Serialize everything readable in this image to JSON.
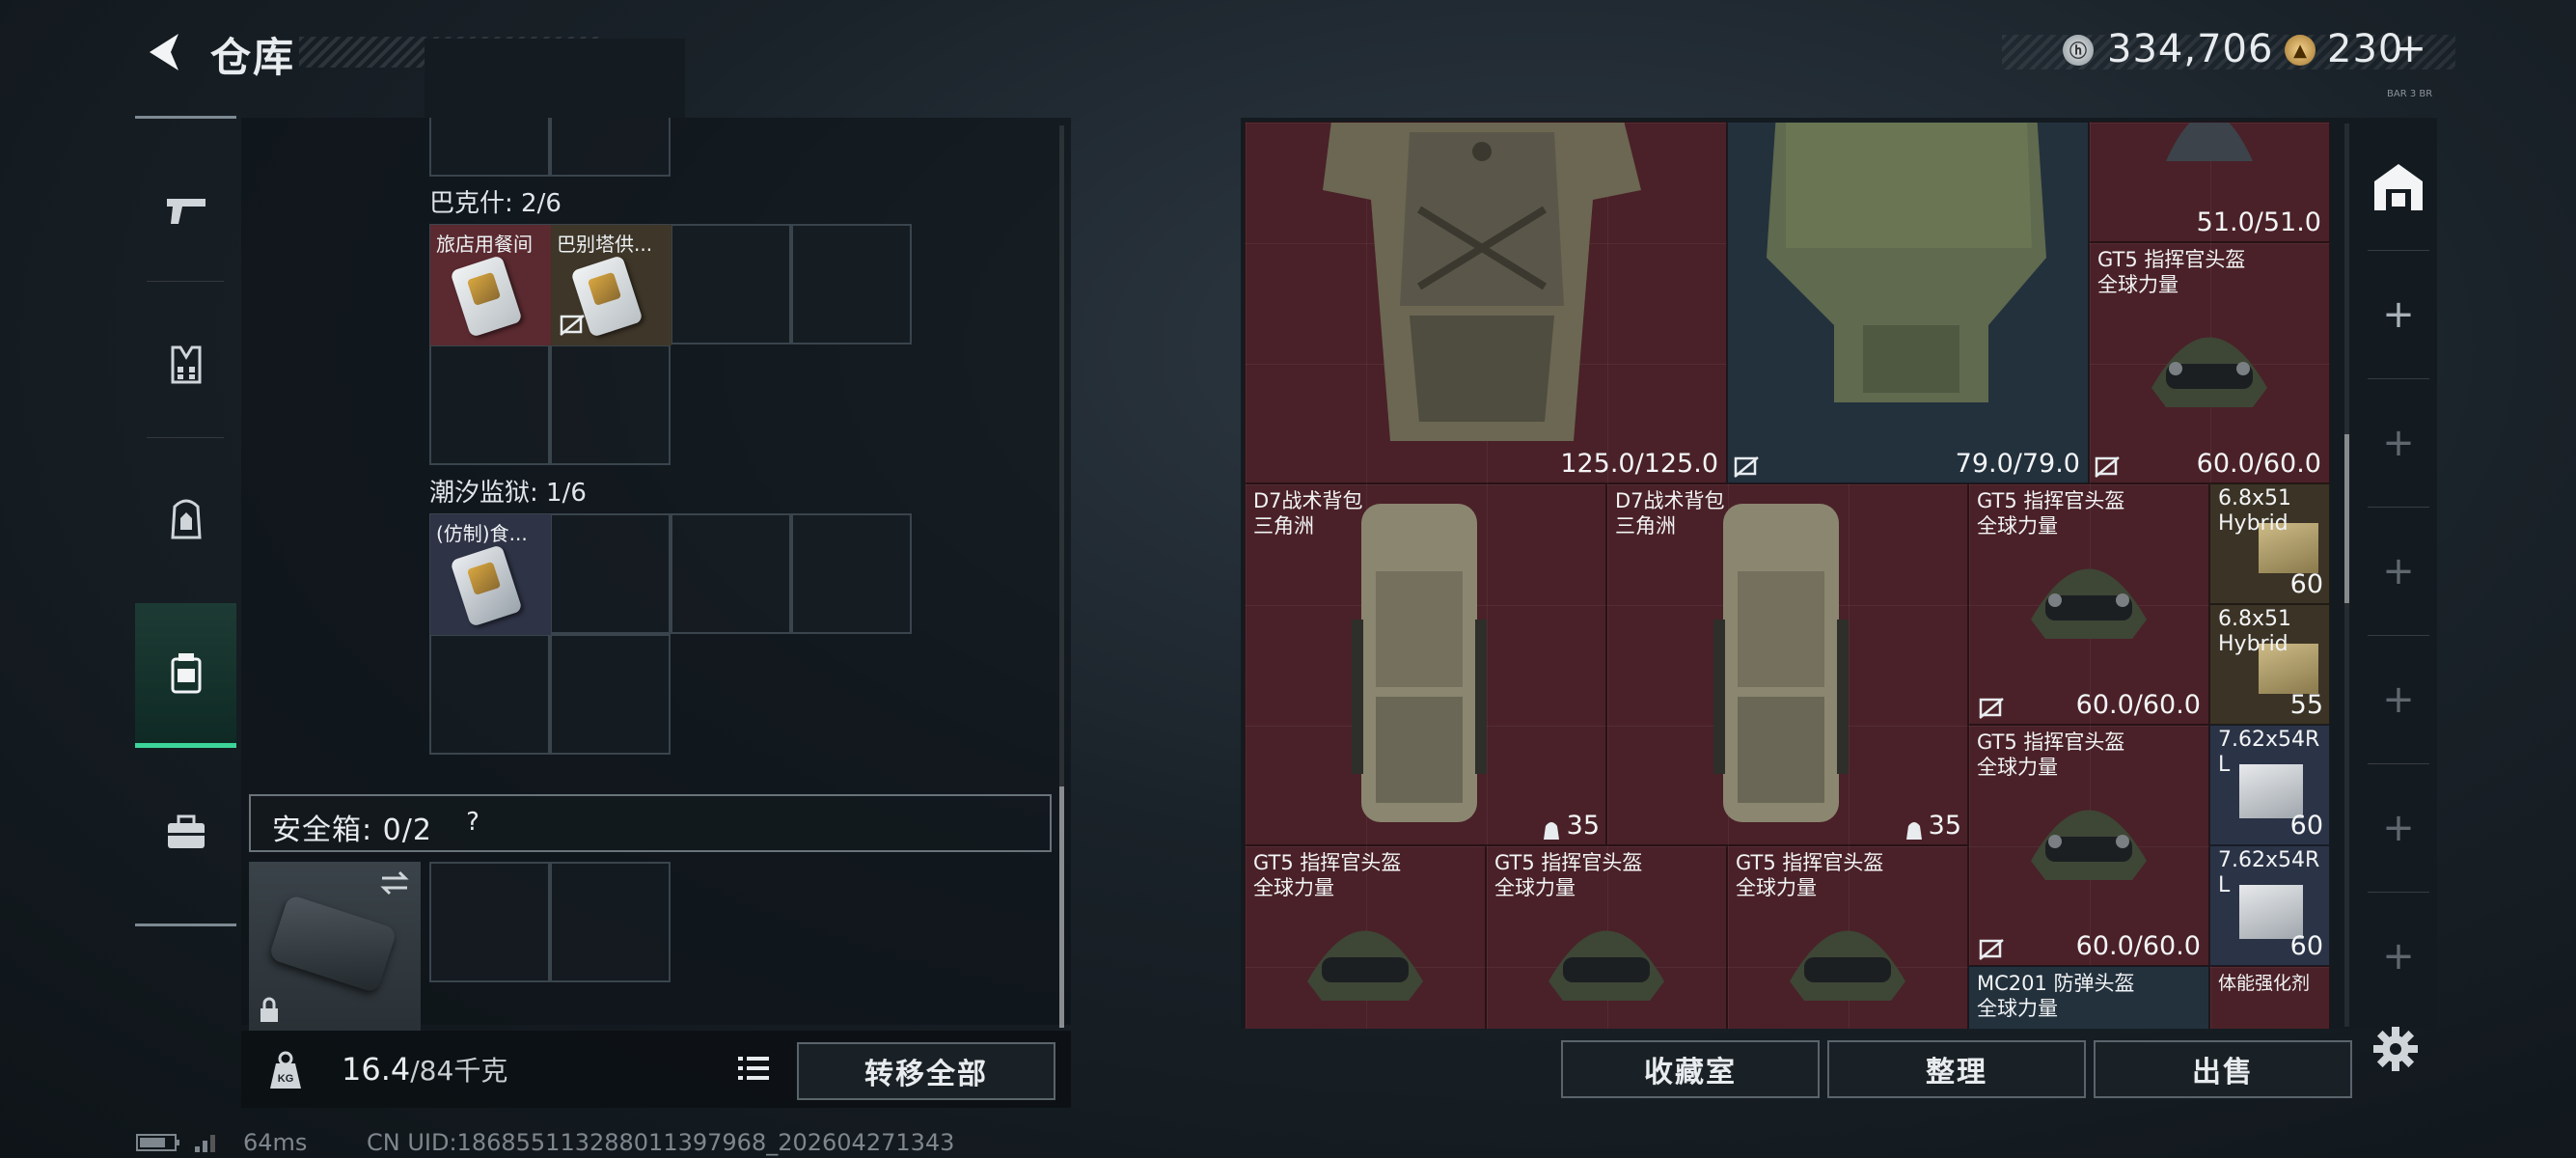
{
  "header": {
    "title": "仓库",
    "currency_a": "334,706",
    "currency_b": "230",
    "currency_b_add": "+",
    "tiny_text": "BAR 3 BR"
  },
  "storage_groups": [
    {
      "label": "巴克什: 2/6",
      "items": [
        "旅店用餐间",
        "巴别塔供..."
      ]
    },
    {
      "label": "潮汐监狱: 1/6",
      "items": [
        "(仿制)食..."
      ]
    }
  ],
  "safe_box": {
    "title": "安全箱: 0/2",
    "help": "?"
  },
  "weight": {
    "current": "16.4",
    "max": "/84千克",
    "lock_label": "KG"
  },
  "buttons": {
    "transfer_all": "转移全部",
    "collection": "收藏室",
    "sort": "整理",
    "sell": "出售"
  },
  "status": {
    "ping": "64ms",
    "uid": "CN UID:1868551132880113979​68_202604271343"
  },
  "warehouse_items": [
    {
      "id": "armor-1",
      "name": "",
      "durability": "125.0/125.0"
    },
    {
      "id": "armor-2",
      "name": "",
      "durability": "79.0/79.0"
    },
    {
      "id": "helmet-top",
      "name": "",
      "durability": "51.0/51.0"
    },
    {
      "id": "helmet-r1",
      "name": "GT5 指挥官头盔\n全球力量",
      "durability": "60.0/60.0"
    },
    {
      "id": "backpack-1",
      "name": "D7战术背包\n三角洲",
      "count": "35"
    },
    {
      "id": "backpack-2",
      "name": "D7战术背包\n三角洲",
      "count": "35"
    },
    {
      "id": "helmet-r2",
      "name": "GT5 指挥官头盔\n全球力量",
      "durability": "60.0/60.0"
    },
    {
      "id": "ammo-1",
      "name": "6.8x51\nHybrid",
      "qty": "60"
    },
    {
      "id": "ammo-2",
      "name": "6.8x51\nHybrid",
      "qty": "55"
    },
    {
      "id": "helmet-r3",
      "name": "GT5 指挥官头盔\n全球力量",
      "durability": "60.0/60.0"
    },
    {
      "id": "ammo-3",
      "name": "7.62x54R\nL",
      "qty": "60"
    },
    {
      "id": "ammo-4",
      "name": "7.62x54R\nL",
      "qty": "60"
    },
    {
      "id": "helmet-b1",
      "name": "GT5 指挥官头盔\n全球力量"
    },
    {
      "id": "helmet-b2",
      "name": "GT5 指挥官头盔\n全球力量"
    },
    {
      "id": "helmet-b3",
      "name": "GT5 指挥官头盔\n全球力量"
    },
    {
      "id": "mc201",
      "name": "MC201 防弹头盔\n全球力量"
    },
    {
      "id": "stim",
      "name": "体能强化剂"
    }
  ]
}
